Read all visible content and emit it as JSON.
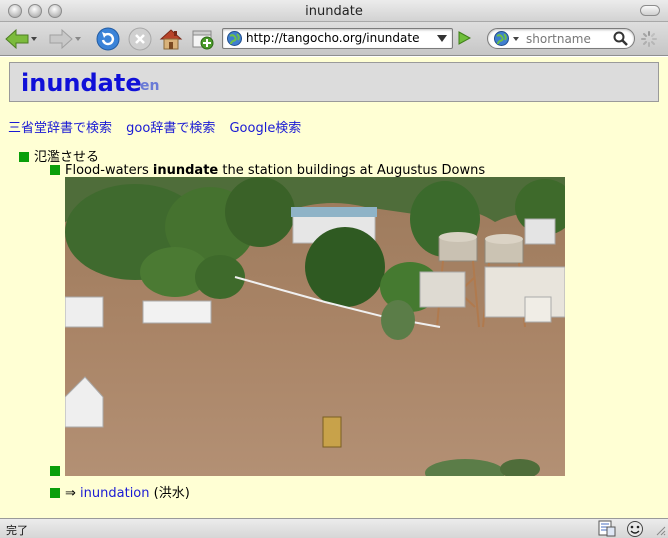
{
  "window": {
    "title": "inundate"
  },
  "toolbar": {
    "url": "http://tangocho.org/inundate",
    "search_placeholder": "shortname"
  },
  "page": {
    "headword": "inundate",
    "lang": "en",
    "links": [
      "三省堂辞書で検索",
      "goo辞書で検索",
      "Google検索"
    ],
    "meaning": "氾濫させる",
    "example": {
      "before": "Flood-waters ",
      "keyword": "inundate",
      "after": " the station buildings at Augustus Downs"
    },
    "related": {
      "arrow": "⇒",
      "link": "inundation",
      "note": "(洪水)"
    }
  },
  "status": {
    "text": "完了"
  },
  "colors": {
    "page_background": "#ffffd4",
    "headword": "#1010d8",
    "link": "#1a1ad4",
    "bullet": "#0a9f0a"
  },
  "icons": [
    "back-arrow-icon",
    "forward-arrow-icon",
    "reload-icon",
    "stop-icon",
    "home-icon",
    "add-bookmark-icon",
    "globe-icon",
    "go-arrow-icon",
    "magnifier-icon",
    "throbber-icon",
    "page-info-icon",
    "smiley-icon"
  ]
}
